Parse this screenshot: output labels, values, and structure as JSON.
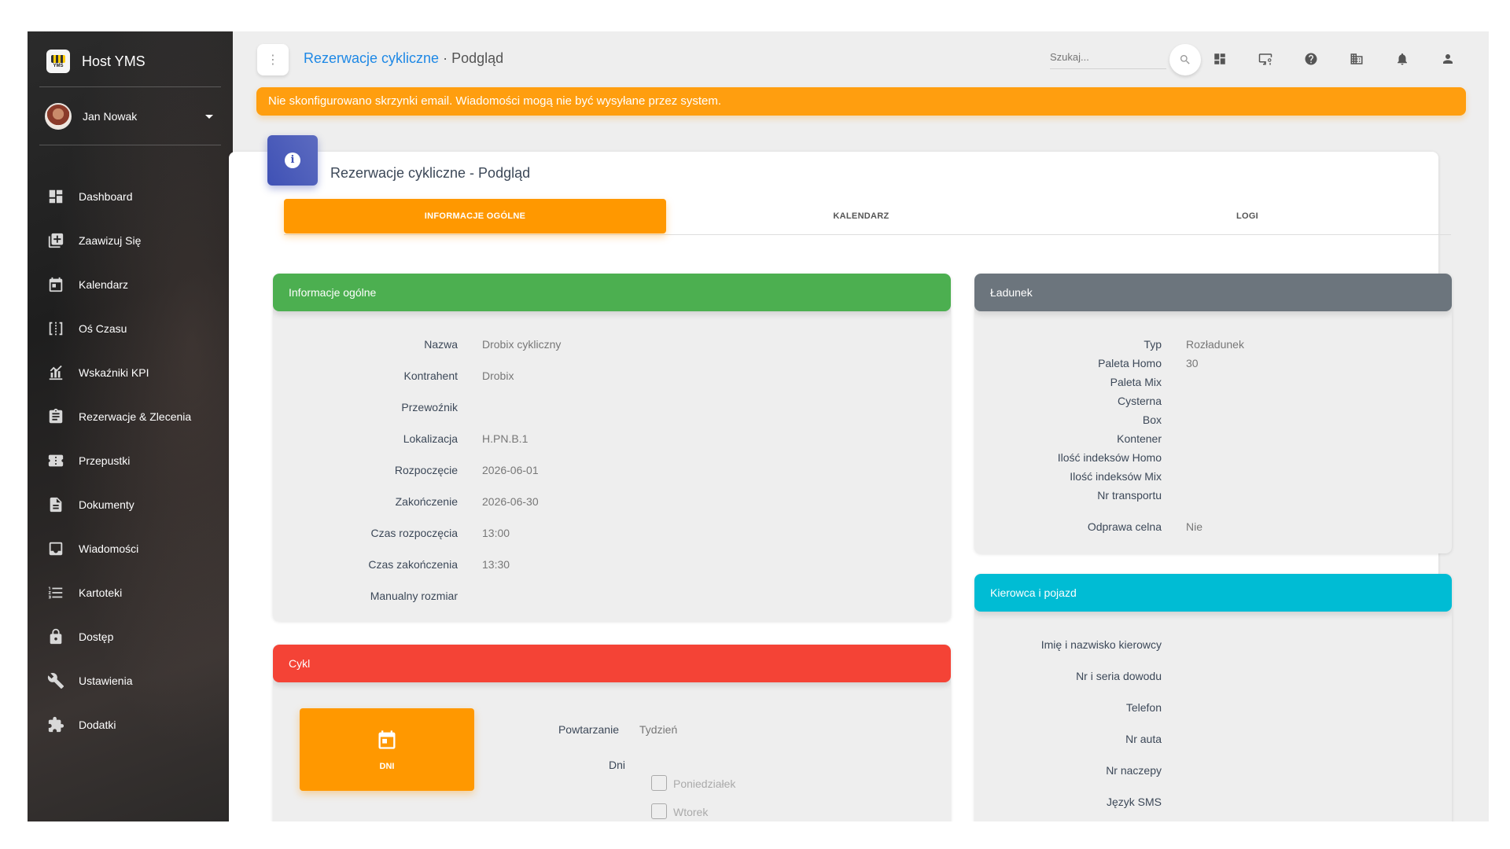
{
  "app": {
    "name": "Host YMS",
    "logo_tag": "YMS"
  },
  "user": {
    "name": "Jan Nowak"
  },
  "sidebar": {
    "items": [
      {
        "label": "Dashboard",
        "icon": "dashboard-icon"
      },
      {
        "label": "Zaawizuj Się",
        "icon": "add-box-icon"
      },
      {
        "label": "Kalendarz",
        "icon": "calendar-icon"
      },
      {
        "label": "Oś Czasu",
        "icon": "timeline-icon"
      },
      {
        "label": "Wskaźniki KPI",
        "icon": "kpi-chart-icon"
      },
      {
        "label": "Rezerwacje & Zlecenia",
        "icon": "clipboard-icon"
      },
      {
        "label": "Przepustki",
        "icon": "ticket-icon"
      },
      {
        "label": "Dokumenty",
        "icon": "document-icon"
      },
      {
        "label": "Wiadomości",
        "icon": "inbox-icon"
      },
      {
        "label": "Kartoteki",
        "icon": "list-icon"
      },
      {
        "label": "Dostęp",
        "icon": "lock-icon"
      },
      {
        "label": "Ustawienia",
        "icon": "wrench-icon"
      },
      {
        "label": "Dodatki",
        "icon": "puzzle-icon"
      }
    ]
  },
  "topbar": {
    "menu_glyph": "⋮",
    "breadcrumb_link": "Rezerwacje cykliczne",
    "breadcrumb_sep": " · ",
    "breadcrumb_current": "Podgląd",
    "search_placeholder": "Szukaj..."
  },
  "alert": {
    "text": "Nie skonfigurowano skrzynki email. Wiadomości mogą nie być wysyłane przez system."
  },
  "page": {
    "title": "Rezerwacje cykliczne - Podgląd",
    "icon_glyph": "i",
    "tabs": [
      "INFORMACJE OGÓLNE",
      "KALENDARZ",
      "LOGI"
    ]
  },
  "info_panel": {
    "title": "Informacje ogólne",
    "color": "#4caf50",
    "rows": [
      {
        "label": "Nazwa",
        "value": "Drobix cykliczny"
      },
      {
        "label": "Kontrahent",
        "value": "Drobix"
      },
      {
        "label": "Przewoźnik",
        "value": ""
      },
      {
        "label": "Lokalizacja",
        "value": "H.PN.B.1"
      },
      {
        "label": "Rozpoczęcie",
        "value": "2026-06-01"
      },
      {
        "label": "Zakończenie",
        "value": "2026-06-30"
      },
      {
        "label": "Czas rozpoczęcia",
        "value": "13:00"
      },
      {
        "label": "Czas zakończenia",
        "value": "13:30"
      },
      {
        "label": "Manualny rozmiar",
        "value": ""
      }
    ]
  },
  "cycle_panel": {
    "title": "Cykl",
    "color": "#f44336",
    "tile_label": "DNI",
    "repeat_label": "Powtarzanie",
    "repeat_value": "Tydzień",
    "days_label": "Dni",
    "days": [
      {
        "label": "Poniedziałek",
        "checked": false
      },
      {
        "label": "Wtorek",
        "checked": false
      }
    ]
  },
  "load_panel": {
    "title": "Ładunek",
    "color": "#6c757d",
    "rows": [
      {
        "label": "Typ",
        "value": "Rozładunek"
      },
      {
        "label": "Paleta Homo",
        "value": "30"
      },
      {
        "label": "Paleta Mix",
        "value": ""
      },
      {
        "label": "Cysterna",
        "value": ""
      },
      {
        "label": "Box",
        "value": ""
      },
      {
        "label": "Kontener",
        "value": ""
      },
      {
        "label": "Ilość indeksów Homo",
        "value": ""
      },
      {
        "label": "Ilość indeksów Mix",
        "value": ""
      },
      {
        "label": "Nr transportu",
        "value": ""
      },
      {
        "label": "Odprawa celna",
        "value": "Nie"
      }
    ]
  },
  "driver_panel": {
    "title": "Kierowca i pojazd",
    "color": "#00bcd4",
    "rows": [
      {
        "label": "Imię i nazwisko kierowcy",
        "value": ""
      },
      {
        "label": "Nr i seria dowodu",
        "value": ""
      },
      {
        "label": "Telefon",
        "value": ""
      },
      {
        "label": "Nr auta",
        "value": ""
      },
      {
        "label": "Nr naczepy",
        "value": ""
      },
      {
        "label": "Język SMS",
        "value": ""
      }
    ]
  },
  "colors": {
    "accent": "#ff9800",
    "link": "#1e88e5",
    "alert": "#ff9e0f",
    "card_icon": "#3f51b5"
  }
}
